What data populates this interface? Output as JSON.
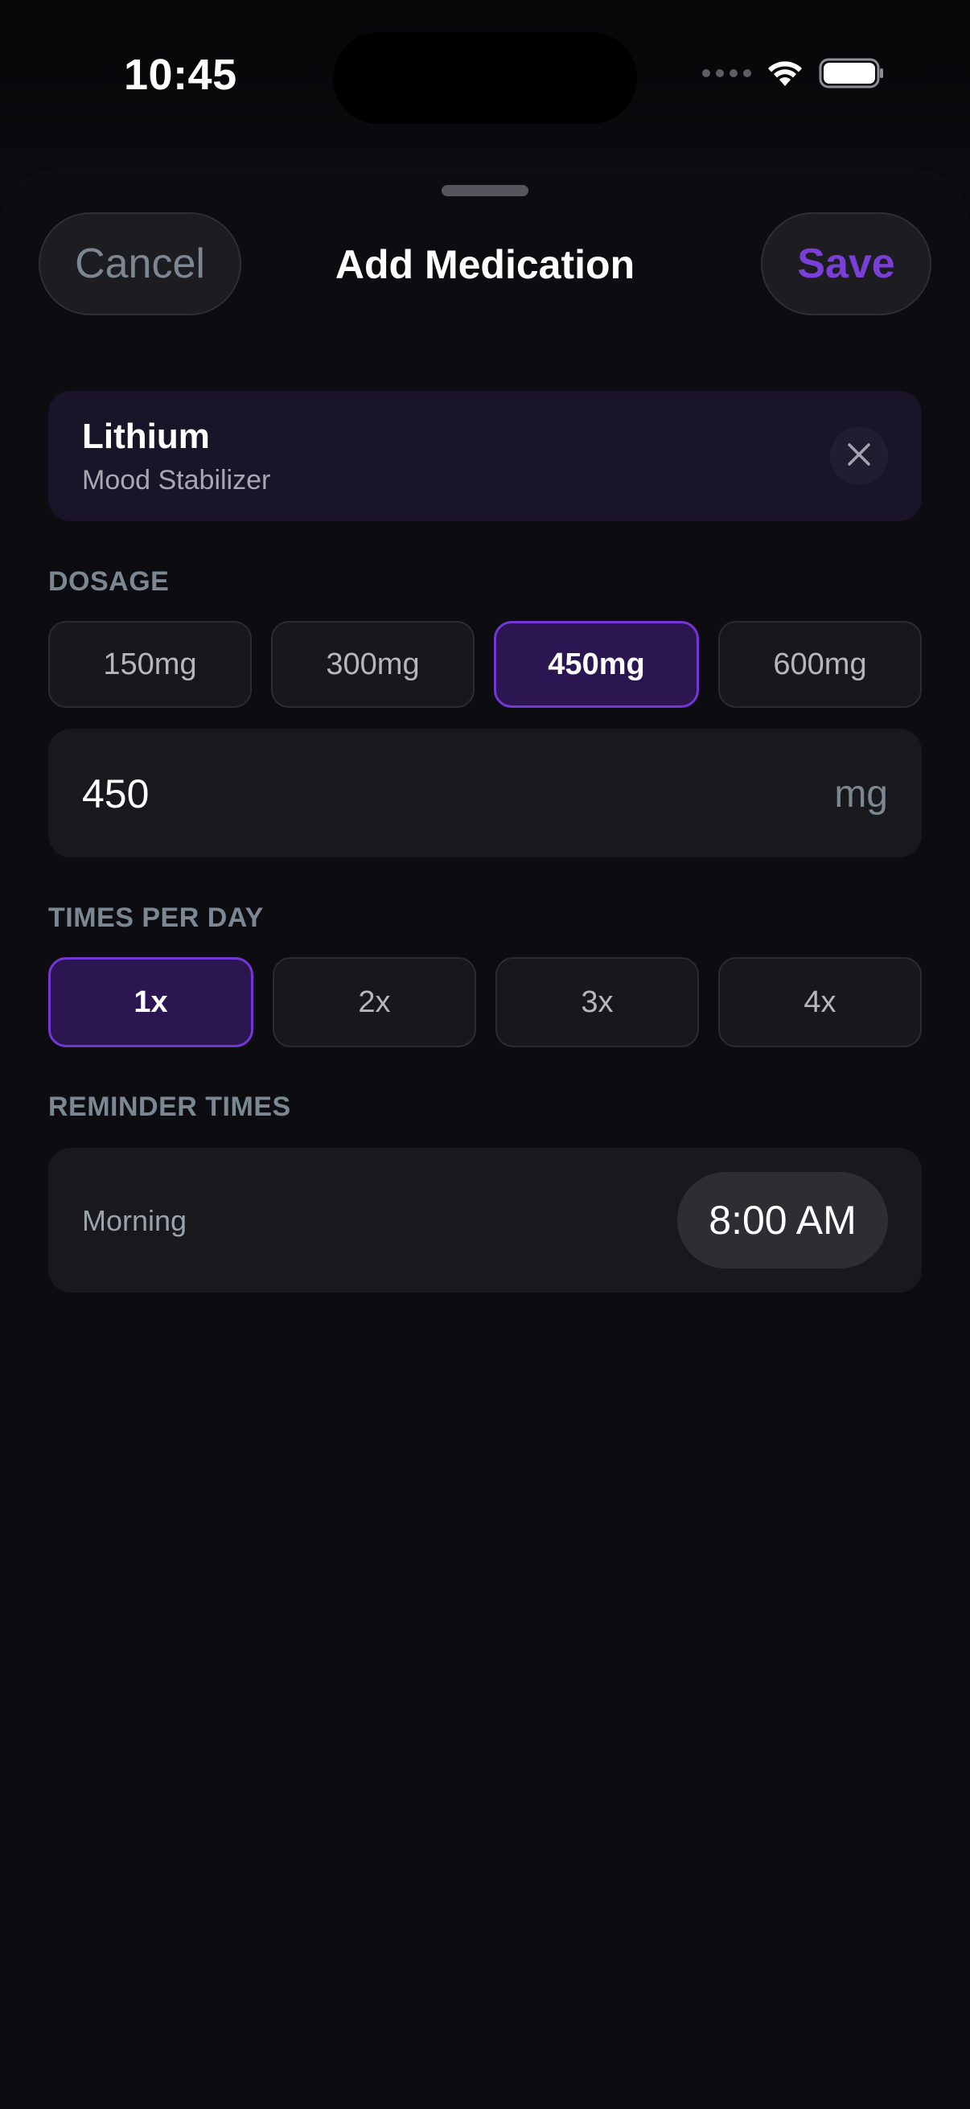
{
  "status_bar": {
    "time": "10:45"
  },
  "header": {
    "title": "Add Medication",
    "cancel_label": "Cancel",
    "save_label": "Save",
    "accent_color": "#7a3fd6"
  },
  "medication": {
    "name": "Lithium",
    "class": "Mood Stabilizer"
  },
  "dosage": {
    "section_label": "DOSAGE",
    "options": [
      "150mg",
      "300mg",
      "450mg",
      "600mg"
    ],
    "selected": "450mg",
    "amount_value": "450",
    "unit": "mg"
  },
  "frequency": {
    "section_label": "TIMES PER DAY",
    "options": [
      "1x",
      "2x",
      "3x",
      "4x"
    ],
    "selected": "1x"
  },
  "reminders": {
    "section_label": "REMINDER TIMES",
    "items": [
      {
        "label": "Morning",
        "time": "8:00 AM"
      }
    ]
  },
  "icons": {
    "clear": "close-icon",
    "wifi": "wifi-icon",
    "battery": "battery-icon",
    "cellular": "cellular-signal-icon"
  }
}
